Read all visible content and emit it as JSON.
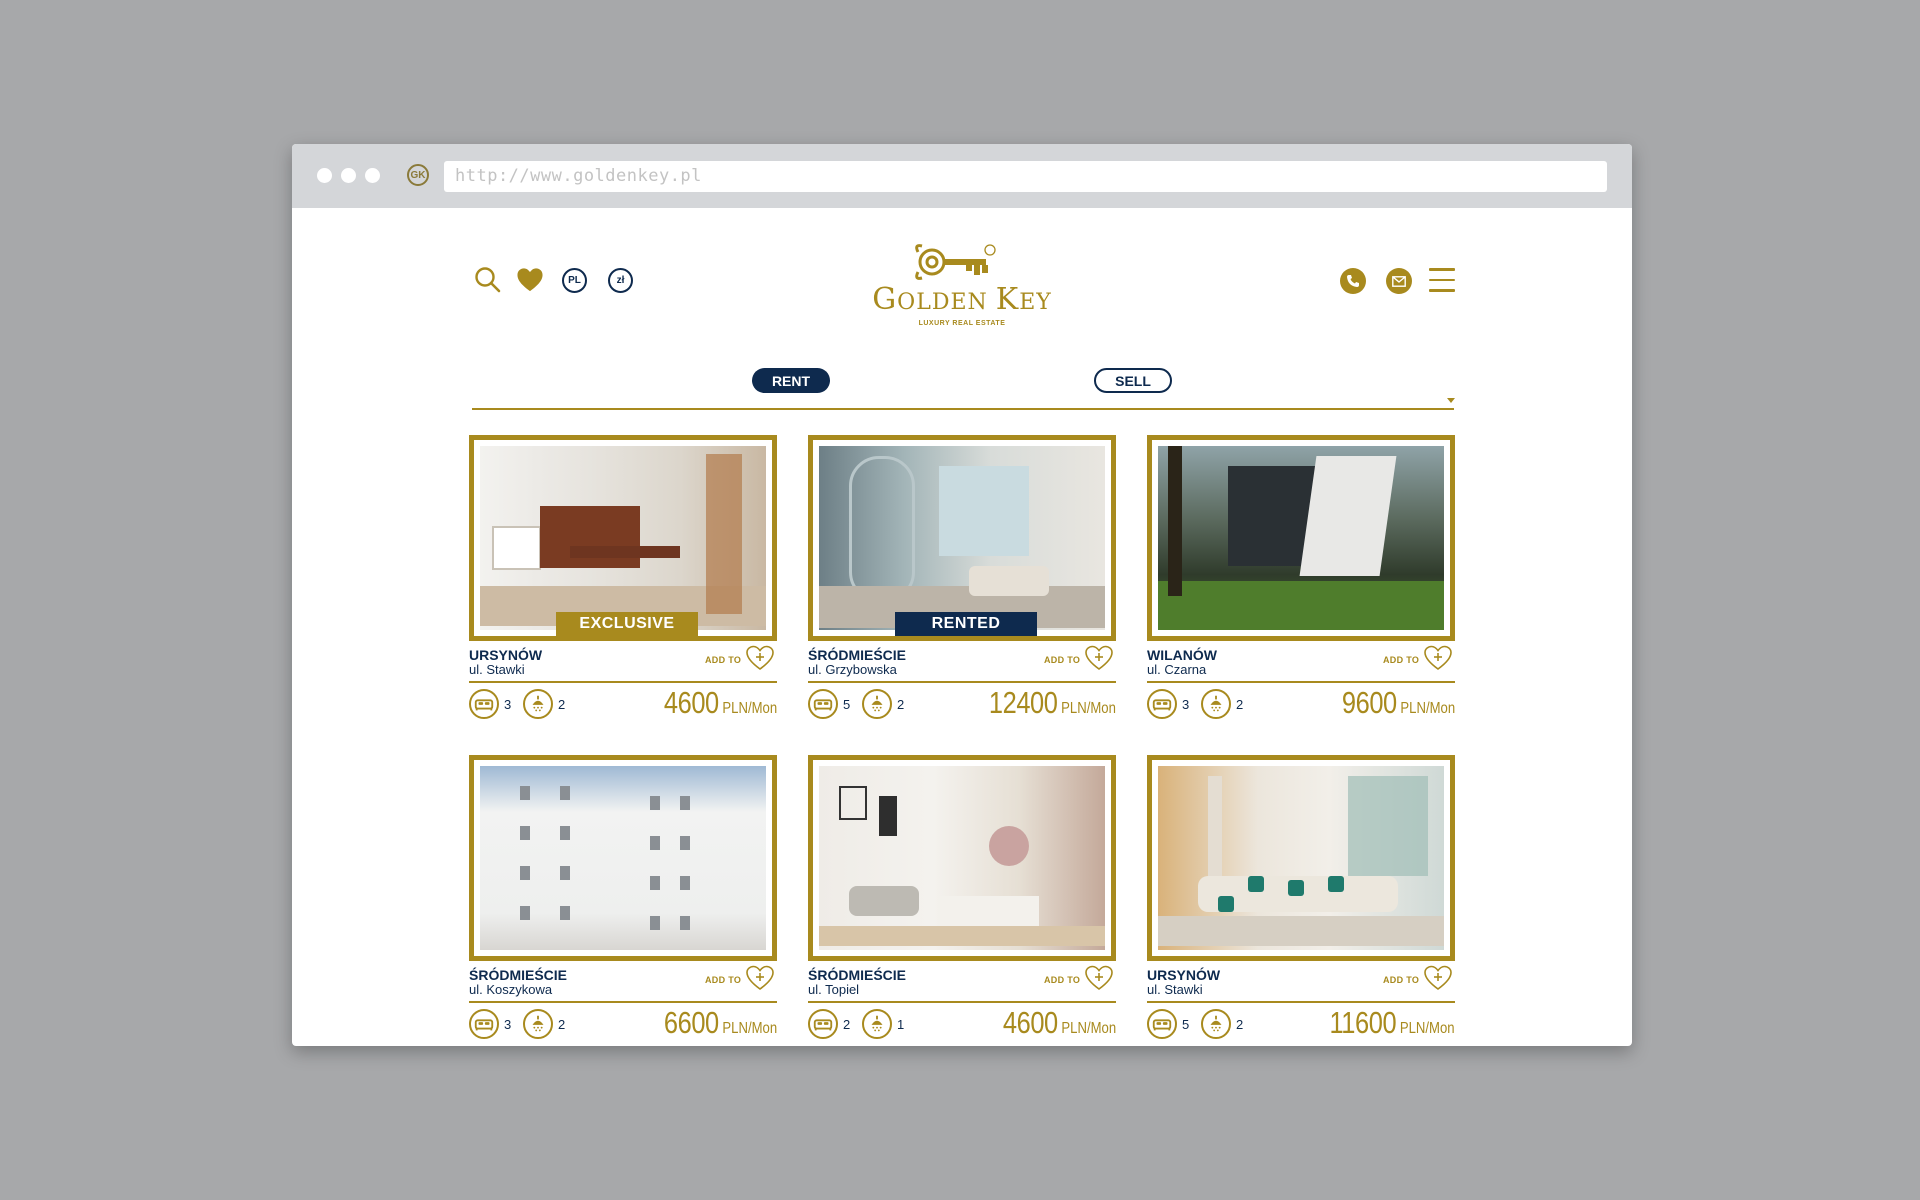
{
  "browser": {
    "url": "http://www.goldenkey.pl",
    "favicon": "GK"
  },
  "header": {
    "lang_label": "PL",
    "currency_label": "zł",
    "logo_name_first": "G",
    "logo_name_rest1": "OLDEN ",
    "logo_name_k": "K",
    "logo_name_rest2": "EY",
    "logo_tagline": "LUXURY REAL ESTATE",
    "icons": [
      "search-icon",
      "heart-icon",
      "phone-icon",
      "mail-icon",
      "menu-icon"
    ]
  },
  "tabs": {
    "rent": "RENT",
    "sell": "SELL"
  },
  "listings": [
    {
      "district": "URSYNÓW",
      "street": "ul. Stawki",
      "badge": "EXCLUSIVE",
      "badge_color": "#a88a1e",
      "add_label": "ADD TO",
      "beds": "3",
      "baths": "2",
      "price": "4600",
      "unit": "PLN/Mon"
    },
    {
      "district": "ŚRÓDMIEŚCIE",
      "street": "ul. Grzybowska",
      "badge": "RENTED",
      "badge_color": "#0e2a4e",
      "add_label": "ADD TO",
      "beds": "5",
      "baths": "2",
      "price": "12400",
      "unit": "PLN/Mon"
    },
    {
      "district": "WILANÓW",
      "street": "ul. Czarna",
      "badge": "",
      "add_label": "ADD TO",
      "beds": "3",
      "baths": "2",
      "price": "9600",
      "unit": "PLN/Mon"
    },
    {
      "district": "ŚRÓDMIEŚCIE",
      "street": "ul. Koszykowa",
      "badge": "",
      "add_label": "ADD TO",
      "beds": "3",
      "baths": "2",
      "price": "6600",
      "unit": "PLN/Mon"
    },
    {
      "district": "ŚRÓDMIEŚCIE",
      "street": "ul. Topiel",
      "badge": "",
      "add_label": "ADD TO",
      "beds": "2",
      "baths": "1",
      "price": "4600",
      "unit": "PLN/Mon"
    },
    {
      "district": "URSYNÓW",
      "street": "ul. Stawki",
      "badge": "",
      "add_label": "ADD TO",
      "beds": "5",
      "baths": "2",
      "price": "11600",
      "unit": "PLN/Mon"
    }
  ],
  "colors": {
    "gold": "#a88a1e",
    "navy": "#0e2a4e",
    "background": "#a7a8aa"
  }
}
